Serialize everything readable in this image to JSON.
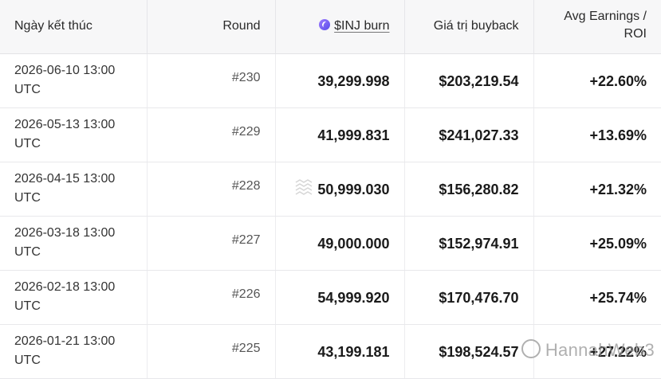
{
  "table": {
    "headers": {
      "date": "Ngày kết thúc",
      "round": "Round",
      "burn": "$INJ burn",
      "value": "Giá trị buyback",
      "roi_line1": "Avg Earnings /",
      "roi_line2": "ROI"
    },
    "rows": [
      {
        "date": "2026-06-10 13:00",
        "tz": "UTC",
        "round": "#230",
        "burn": "39,299.998",
        "value": "$203,219.54",
        "roi": "+22.60%"
      },
      {
        "date": "2026-05-13 13:00",
        "tz": "UTC",
        "round": "#229",
        "burn": "41,999.831",
        "value": "$241,027.33",
        "roi": "+13.69%"
      },
      {
        "date": "2026-04-15 13:00",
        "tz": "UTC",
        "round": "#228",
        "burn": "50,999.030",
        "value": "$156,280.82",
        "roi": "+21.32%"
      },
      {
        "date": "2026-03-18 13:00",
        "tz": "UTC",
        "round": "#227",
        "burn": "49,000.000",
        "value": "$152,974.91",
        "roi": "+25.09%"
      },
      {
        "date": "2026-02-18 13:00",
        "tz": "UTC",
        "round": "#226",
        "burn": "54,999.920",
        "value": "$170,476.70",
        "roi": "+25.74%"
      },
      {
        "date": "2026-01-21 13:00",
        "tz": "UTC",
        "round": "#225",
        "burn": "43,199.181",
        "value": "$198,524.57",
        "roi": "+27.22%"
      }
    ]
  },
  "watermark": {
    "text": "HannahWeb3"
  },
  "icons": {
    "token": "inj-token-icon",
    "stamp": "stamp-icon"
  },
  "colors": {
    "header_bg": "#f7f7f8",
    "token_purple": "#6b5cf0"
  }
}
